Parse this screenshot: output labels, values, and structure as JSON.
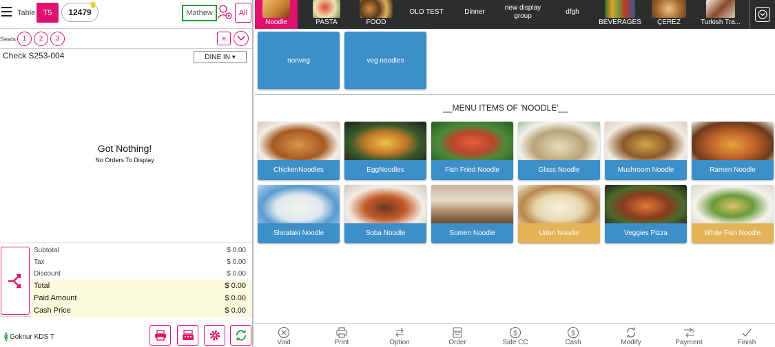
{
  "header": {
    "table_label": "Table",
    "table_number": "T5",
    "check_number": "12479",
    "server_name": "Mathew",
    "all_label": "All"
  },
  "seats": {
    "label": "Seats",
    "items": [
      "1",
      "2",
      "3"
    ],
    "add_label": "+"
  },
  "order": {
    "check_label": "Check S253-004",
    "order_type": "DINE IN ▾",
    "empty_title": "Got Nothing!",
    "empty_subtitle": "No Orders To Display"
  },
  "totals": [
    {
      "label": "Subtotal",
      "value": "$ 0.00",
      "highlight": false
    },
    {
      "label": "Tax",
      "value": "$ 0.00",
      "highlight": false
    },
    {
      "label": "Discount",
      "value": "$ 0.00",
      "highlight": false
    },
    {
      "label": "Total",
      "value": "$ 0.00",
      "highlight": true
    },
    {
      "label": "Paid Amount",
      "value": "$ 0.00",
      "highlight": true
    },
    {
      "label": "Cash Price",
      "value": "$ 0.00",
      "highlight": true
    }
  ],
  "footer": {
    "kds_name": "Goknur KDS T"
  },
  "categories": [
    {
      "label": "Noodle",
      "image": true,
      "active": true
    },
    {
      "label": "PASTA",
      "image": true,
      "active": false
    },
    {
      "label": "FOOD",
      "image": true,
      "active": false
    },
    {
      "label": "OLO TEST",
      "image": false,
      "active": false
    },
    {
      "label": "Dinner",
      "image": false,
      "active": false
    },
    {
      "label": "new display group",
      "image": false,
      "active": false
    },
    {
      "label": "dfgh",
      "image": false,
      "active": false
    },
    {
      "label": "BEVERAGES",
      "image": true,
      "active": false
    },
    {
      "label": "ÇEREZ",
      "image": true,
      "active": false
    },
    {
      "label": "Turkish Tra...",
      "image": true,
      "active": false
    }
  ],
  "groups": [
    "nonveg",
    "veg noodles"
  ],
  "menu_heading": "__MENU ITEMS OF 'NOODLE'__",
  "menu_items": [
    {
      "label": "ChickenNoodles",
      "color": "#3d8fc9"
    },
    {
      "label": "EggNoodles",
      "color": "#3d8fc9"
    },
    {
      "label": "Fish Fried Noodle",
      "color": "#3d8fc9"
    },
    {
      "label": "Glass Noodle",
      "color": "#3d8fc9"
    },
    {
      "label": "Mushroom Noodle",
      "color": "#3d8fc9"
    },
    {
      "label": "Ramen Noodle",
      "color": "#3d8fc9"
    },
    {
      "label": "Shirataki Noodle",
      "color": "#3d8fc9"
    },
    {
      "label": "Soba Noodle",
      "color": "#3d8fc9"
    },
    {
      "label": "Somen Noodle",
      "color": "#3d8fc9"
    },
    {
      "label": "Udon Noodle",
      "color": "#e3b457"
    },
    {
      "label": "Veggies Pizza",
      "color": "#3d8fc9"
    },
    {
      "label": "White Fish Noodle",
      "color": "#e3b457"
    }
  ],
  "actions": [
    {
      "label": "Void",
      "icon": "void-icon"
    },
    {
      "label": "Print",
      "icon": "print-icon"
    },
    {
      "label": "Option",
      "icon": "option-icon"
    },
    {
      "label": "Order",
      "icon": "order-icon"
    },
    {
      "label": "Side CC",
      "icon": "side-cc-icon"
    },
    {
      "label": "Cash",
      "icon": "cash-icon"
    },
    {
      "label": "Modify",
      "icon": "modify-icon"
    },
    {
      "label": "Payment",
      "icon": "payment-icon"
    },
    {
      "label": "Finish",
      "icon": "finish-icon"
    }
  ],
  "colors": {
    "accent": "#e0116f",
    "tile_blue": "#3d8fc9",
    "tile_gold": "#e3b457",
    "category_bar": "#2d2d2d",
    "server_border": "#1e9a3b",
    "total_highlight": "#fbfadc"
  }
}
